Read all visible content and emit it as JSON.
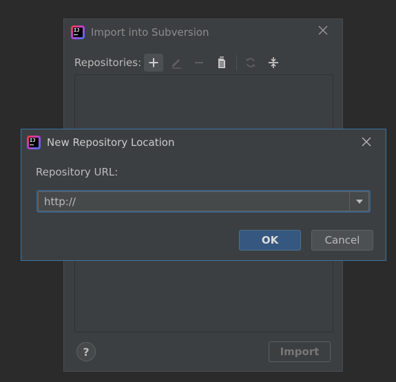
{
  "background_dialog": {
    "title": "Import into Subversion",
    "title_icon": "intellij-idea-icon",
    "app_icon_text": "IJ",
    "close_icon": "close-icon",
    "toolbar": {
      "label": "Repositories:",
      "buttons": [
        {
          "icon": "add-icon",
          "enabled": true
        },
        {
          "icon": "edit-icon",
          "enabled": false
        },
        {
          "icon": "remove-icon",
          "enabled": false
        },
        {
          "icon": "copy-document-icon",
          "enabled": true
        },
        {
          "icon": "refresh-icon",
          "enabled": false
        },
        {
          "icon": "collapse-all-icon",
          "enabled": true
        }
      ]
    },
    "help_label": "?",
    "import_label": "Import"
  },
  "dialog": {
    "title": "New Repository Location",
    "title_icon": "intellij-idea-icon",
    "app_icon_text": "IJ",
    "close_icon": "close-icon",
    "url_label": "Repository URL:",
    "url_value": "http://",
    "dropdown_icon": "chevron-down-icon",
    "ok_label": "OK",
    "cancel_label": "Cancel"
  },
  "colors": {
    "accent_border": "#3b76a8",
    "primary_button": "#365880",
    "panel_background": "#3c3f41",
    "window_background": "#2b2b2b"
  }
}
